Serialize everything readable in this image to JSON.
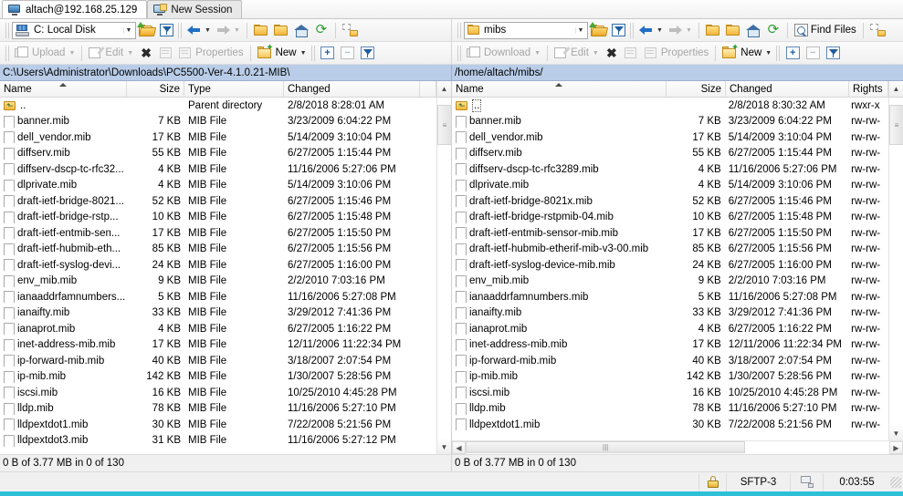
{
  "tabs": [
    {
      "label": "altach@192.168.25.129",
      "icon": "monitor-icon",
      "active": true
    },
    {
      "label": "New Session",
      "icon": "new-session-icon",
      "active": false
    }
  ],
  "left": {
    "drive_selector": {
      "value": "C: Local Disk",
      "icon": "local-disk-icon"
    },
    "toolbar": {
      "open_dir_label": "open-directory",
      "filter_label": "filter",
      "back_label": "back",
      "forward_label": "forward",
      "parent_label": "parent-directory",
      "root_label": "root-directory",
      "home_label": "home-directory",
      "refresh_label": "refresh",
      "sync_browsing_label": "synchronize-browsing"
    },
    "actions": {
      "transfer": "Upload",
      "edit": "Edit",
      "delete": "delete",
      "rename": "rename",
      "properties": "Properties",
      "new": "New",
      "select": "+",
      "unselect": "−",
      "selection_filter": "selection-filter"
    },
    "path": "C:\\Users\\Administrator\\Downloads\\PC5500-Ver-4.1.0.21-MIB\\",
    "columns": [
      "Name",
      "Size",
      "Type",
      "Changed"
    ],
    "sort_column": "Name",
    "sort_direction": "asc",
    "files": [
      {
        "name": "..",
        "size": "",
        "type": "Parent directory",
        "changed": "2/8/2018  8:28:01 AM",
        "icon": "parent-dir-icon"
      },
      {
        "name": "banner.mib",
        "size": "7 KB",
        "type": "MIB File",
        "changed": "3/23/2009  6:04:22 PM",
        "icon": "file-icon"
      },
      {
        "name": "dell_vendor.mib",
        "size": "17 KB",
        "type": "MIB File",
        "changed": "5/14/2009  3:10:04 PM",
        "icon": "file-icon"
      },
      {
        "name": "diffserv.mib",
        "size": "55 KB",
        "type": "MIB File",
        "changed": "6/27/2005  1:15:44 PM",
        "icon": "file-icon"
      },
      {
        "name": "diffserv-dscp-tc-rfc32...",
        "size": "4 KB",
        "type": "MIB File",
        "changed": "11/16/2006  5:27:06 PM",
        "icon": "file-icon"
      },
      {
        "name": "dlprivate.mib",
        "size": "4 KB",
        "type": "MIB File",
        "changed": "5/14/2009  3:10:06 PM",
        "icon": "file-icon"
      },
      {
        "name": "draft-ietf-bridge-8021...",
        "size": "52 KB",
        "type": "MIB File",
        "changed": "6/27/2005  1:15:46 PM",
        "icon": "file-icon"
      },
      {
        "name": "draft-ietf-bridge-rstp...",
        "size": "10 KB",
        "type": "MIB File",
        "changed": "6/27/2005  1:15:48 PM",
        "icon": "file-icon"
      },
      {
        "name": "draft-ietf-entmib-sen...",
        "size": "17 KB",
        "type": "MIB File",
        "changed": "6/27/2005  1:15:50 PM",
        "icon": "file-icon"
      },
      {
        "name": "draft-ietf-hubmib-eth...",
        "size": "85 KB",
        "type": "MIB File",
        "changed": "6/27/2005  1:15:56 PM",
        "icon": "file-icon"
      },
      {
        "name": "draft-ietf-syslog-devi...",
        "size": "24 KB",
        "type": "MIB File",
        "changed": "6/27/2005  1:16:00 PM",
        "icon": "file-icon"
      },
      {
        "name": "env_mib.mib",
        "size": "9 KB",
        "type": "MIB File",
        "changed": "2/2/2010  7:03:16 PM",
        "icon": "file-icon"
      },
      {
        "name": "ianaaddrfamnumbers...",
        "size": "5 KB",
        "type": "MIB File",
        "changed": "11/16/2006  5:27:08 PM",
        "icon": "file-icon"
      },
      {
        "name": "ianaifty.mib",
        "size": "33 KB",
        "type": "MIB File",
        "changed": "3/29/2012  7:41:36 PM",
        "icon": "file-icon"
      },
      {
        "name": "ianaprot.mib",
        "size": "4 KB",
        "type": "MIB File",
        "changed": "6/27/2005  1:16:22 PM",
        "icon": "file-icon"
      },
      {
        "name": "inet-address-mib.mib",
        "size": "17 KB",
        "type": "MIB File",
        "changed": "12/11/2006  11:22:34 PM",
        "icon": "file-icon"
      },
      {
        "name": "ip-forward-mib.mib",
        "size": "40 KB",
        "type": "MIB File",
        "changed": "3/18/2007  2:07:54 PM",
        "icon": "file-icon"
      },
      {
        "name": "ip-mib.mib",
        "size": "142 KB",
        "type": "MIB File",
        "changed": "1/30/2007  5:28:56 PM",
        "icon": "file-icon"
      },
      {
        "name": "iscsi.mib",
        "size": "16 KB",
        "type": "MIB File",
        "changed": "10/25/2010  4:45:28 PM",
        "icon": "file-icon"
      },
      {
        "name": "lldp.mib",
        "size": "78 KB",
        "type": "MIB File",
        "changed": "11/16/2006  5:27:10 PM",
        "icon": "file-icon"
      },
      {
        "name": "lldpextdot1.mib",
        "size": "30 KB",
        "type": "MIB File",
        "changed": "7/22/2008  5:21:56 PM",
        "icon": "file-icon"
      },
      {
        "name": "lldpextdot3.mib",
        "size": "31 KB",
        "type": "MIB File",
        "changed": "11/16/2006  5:27:12 PM",
        "icon": "file-icon"
      }
    ],
    "selection_status": "0 B of 3.77 MB in 0 of 130"
  },
  "right": {
    "drive_selector": {
      "value": "mibs",
      "icon": "remote-folder-icon"
    },
    "actions": {
      "transfer": "Download",
      "edit": "Edit",
      "properties": "Properties",
      "new": "New",
      "select": "+",
      "unselect": "−",
      "find_files": "Find Files"
    },
    "path": "/home/altach/mibs/",
    "columns": [
      "Name",
      "Size",
      "Changed",
      "Rights"
    ],
    "sort_column": "Name",
    "sort_direction": "asc",
    "files": [
      {
        "name": "..",
        "size": "",
        "changed": "2/8/2018 8:30:32 AM",
        "rights": "rwxr-x",
        "icon": "parent-dir-icon",
        "focused": true
      },
      {
        "name": "banner.mib",
        "size": "7 KB",
        "changed": "3/23/2009 6:04:22 PM",
        "rights": "rw-rw-",
        "icon": "file-icon"
      },
      {
        "name": "dell_vendor.mib",
        "size": "17 KB",
        "changed": "5/14/2009 3:10:04 PM",
        "rights": "rw-rw-",
        "icon": "file-icon"
      },
      {
        "name": "diffserv.mib",
        "size": "55 KB",
        "changed": "6/27/2005 1:15:44 PM",
        "rights": "rw-rw-",
        "icon": "file-icon"
      },
      {
        "name": "diffserv-dscp-tc-rfc3289.mib",
        "size": "4 KB",
        "changed": "11/16/2006 5:27:06 PM",
        "rights": "rw-rw-",
        "icon": "file-icon"
      },
      {
        "name": "dlprivate.mib",
        "size": "4 KB",
        "changed": "5/14/2009 3:10:06 PM",
        "rights": "rw-rw-",
        "icon": "file-icon"
      },
      {
        "name": "draft-ietf-bridge-8021x.mib",
        "size": "52 KB",
        "changed": "6/27/2005 1:15:46 PM",
        "rights": "rw-rw-",
        "icon": "file-icon"
      },
      {
        "name": "draft-ietf-bridge-rstpmib-04.mib",
        "size": "10 KB",
        "changed": "6/27/2005 1:15:48 PM",
        "rights": "rw-rw-",
        "icon": "file-icon"
      },
      {
        "name": "draft-ietf-entmib-sensor-mib.mib",
        "size": "17 KB",
        "changed": "6/27/2005 1:15:50 PM",
        "rights": "rw-rw-",
        "icon": "file-icon"
      },
      {
        "name": "draft-ietf-hubmib-etherif-mib-v3-00.mib",
        "size": "85 KB",
        "changed": "6/27/2005 1:15:56 PM",
        "rights": "rw-rw-",
        "icon": "file-icon"
      },
      {
        "name": "draft-ietf-syslog-device-mib.mib",
        "size": "24 KB",
        "changed": "6/27/2005 1:16:00 PM",
        "rights": "rw-rw-",
        "icon": "file-icon"
      },
      {
        "name": "env_mib.mib",
        "size": "9 KB",
        "changed": "2/2/2010 7:03:16 PM",
        "rights": "rw-rw-",
        "icon": "file-icon"
      },
      {
        "name": "ianaaddrfamnumbers.mib",
        "size": "5 KB",
        "changed": "11/16/2006 5:27:08 PM",
        "rights": "rw-rw-",
        "icon": "file-icon"
      },
      {
        "name": "ianaifty.mib",
        "size": "33 KB",
        "changed": "3/29/2012 7:41:36 PM",
        "rights": "rw-rw-",
        "icon": "file-icon"
      },
      {
        "name": "ianaprot.mib",
        "size": "4 KB",
        "changed": "6/27/2005 1:16:22 PM",
        "rights": "rw-rw-",
        "icon": "file-icon"
      },
      {
        "name": "inet-address-mib.mib",
        "size": "17 KB",
        "changed": "12/11/2006 11:22:34 PM",
        "rights": "rw-rw-",
        "icon": "file-icon"
      },
      {
        "name": "ip-forward-mib.mib",
        "size": "40 KB",
        "changed": "3/18/2007 2:07:54 PM",
        "rights": "rw-rw-",
        "icon": "file-icon"
      },
      {
        "name": "ip-mib.mib",
        "size": "142 KB",
        "changed": "1/30/2007 5:28:56 PM",
        "rights": "rw-rw-",
        "icon": "file-icon"
      },
      {
        "name": "iscsi.mib",
        "size": "16 KB",
        "changed": "10/25/2010 4:45:28 PM",
        "rights": "rw-rw-",
        "icon": "file-icon"
      },
      {
        "name": "lldp.mib",
        "size": "78 KB",
        "changed": "11/16/2006 5:27:10 PM",
        "rights": "rw-rw-",
        "icon": "file-icon"
      },
      {
        "name": "lldpextdot1.mib",
        "size": "30 KB",
        "changed": "7/22/2008 5:21:56 PM",
        "rights": "rw-rw-",
        "icon": "file-icon"
      }
    ],
    "selection_status": "0 B of 3.77 MB in 0 of 130"
  },
  "statusbar": {
    "protocol": "SFTP-3",
    "elapsed": "0:03:55",
    "lock_icon": "lock-icon",
    "network_icon": "network-icon"
  },
  "colors": {
    "path_bar": "#b9cde8",
    "accent_bottom": "#2fc0d8",
    "folder": "#f3b73c",
    "arrow_active": "#1f6fc4"
  }
}
